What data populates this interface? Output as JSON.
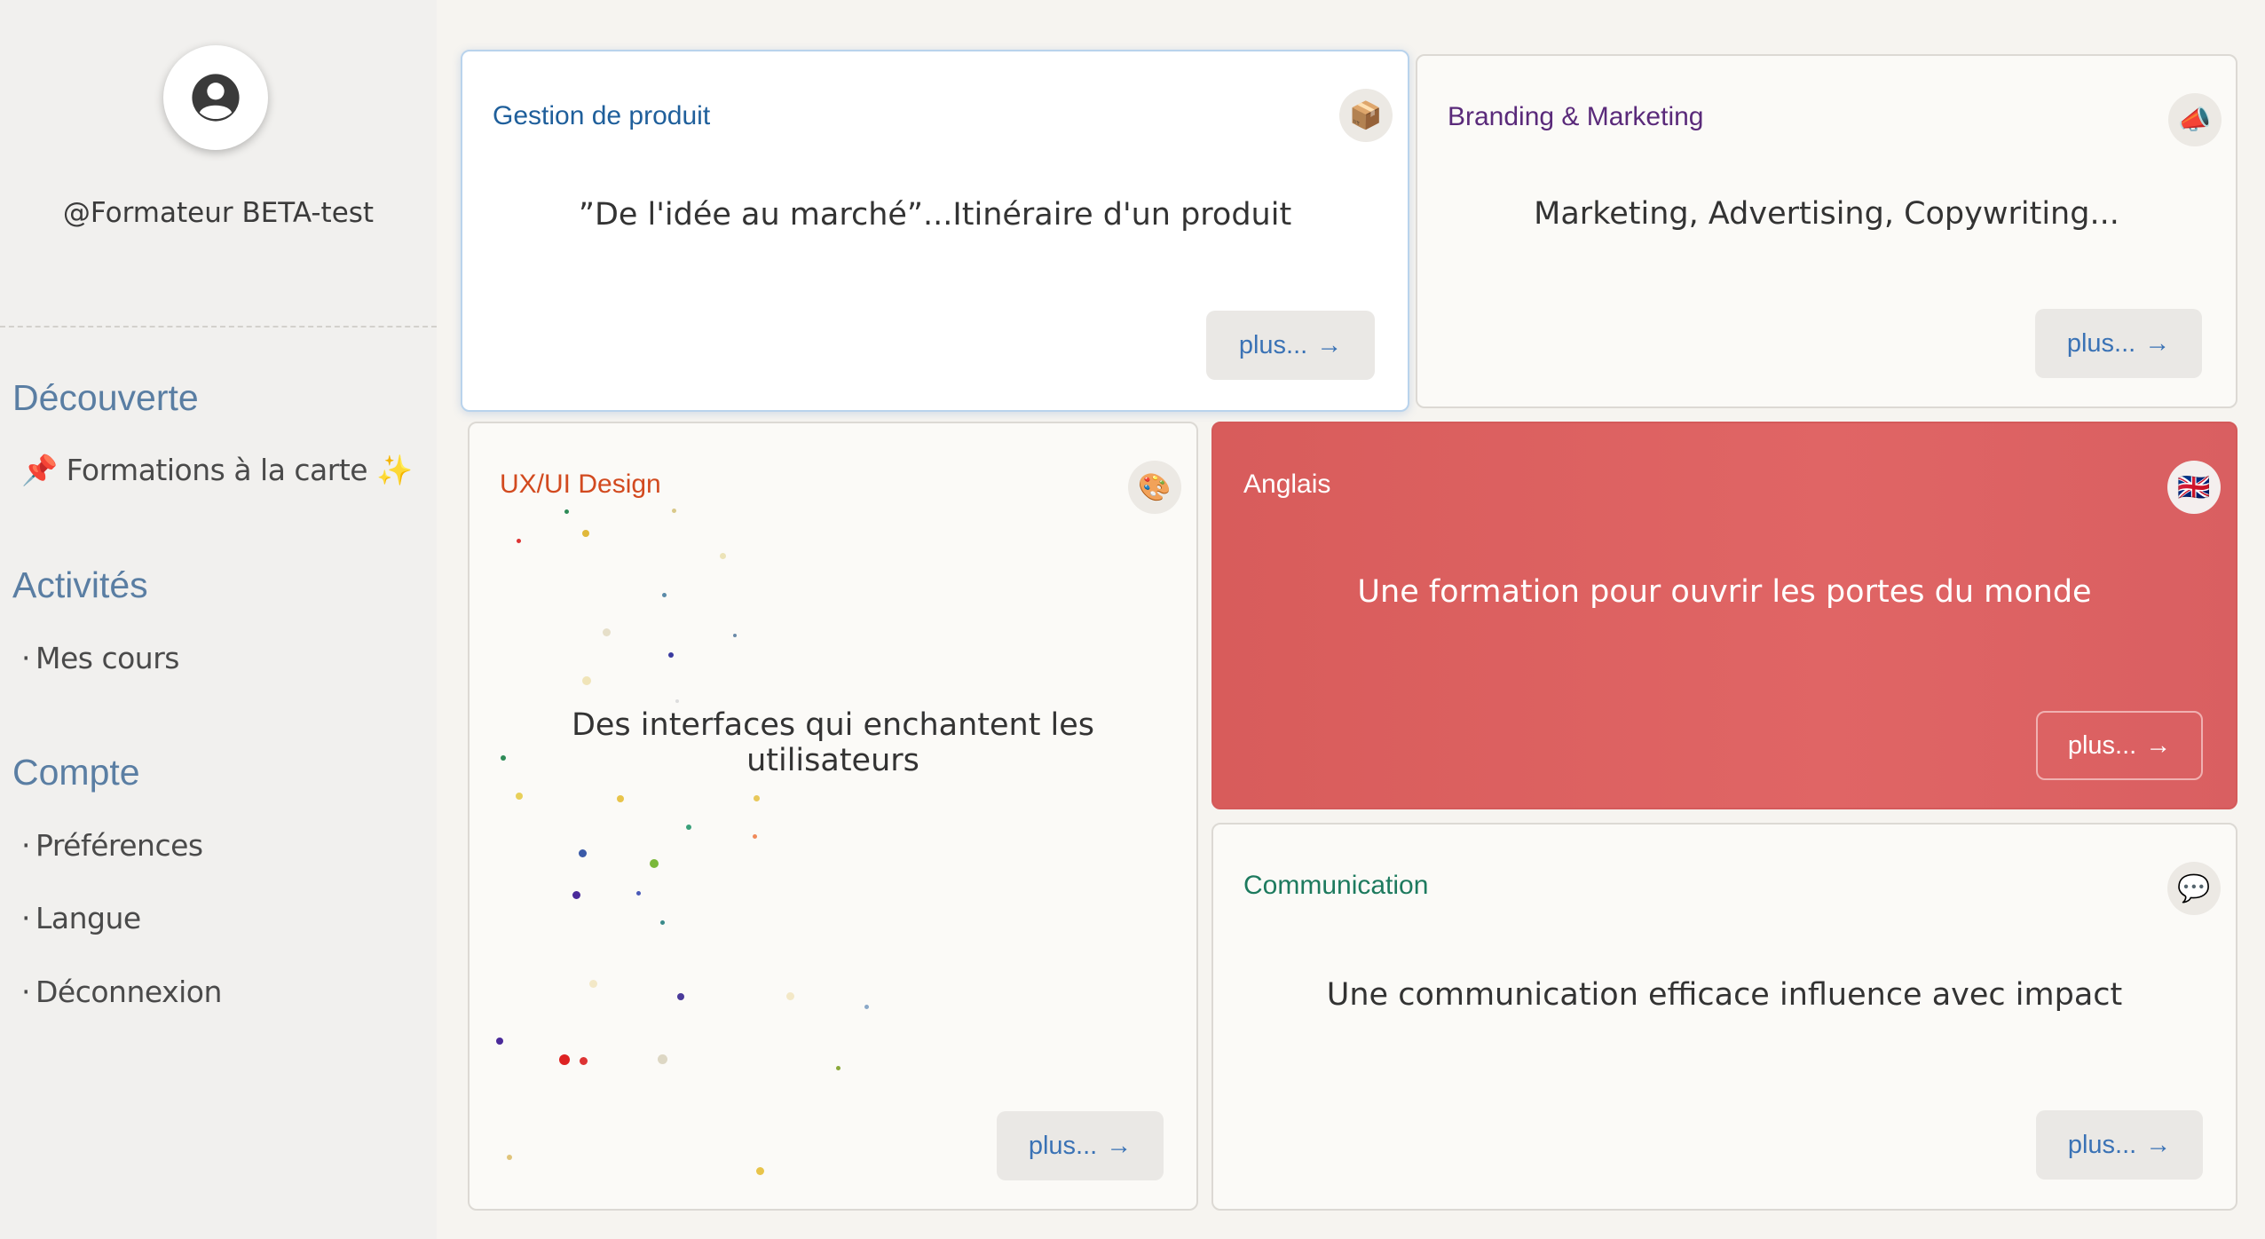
{
  "sidebar": {
    "username": "@Formateur BETA-test",
    "sections": [
      {
        "title": "Découverte",
        "items": [
          {
            "label": "📌 Formations à la carte  ✨"
          }
        ]
      },
      {
        "title": "Activités",
        "items": [
          {
            "label": "Mes cours"
          }
        ]
      },
      {
        "title": "Compte",
        "items": [
          {
            "label": "Préférences"
          },
          {
            "label": "Langue"
          },
          {
            "label": "Déconnexion"
          }
        ]
      }
    ]
  },
  "cards": {
    "produit": {
      "title": "Gestion de produit",
      "description": "”De l'idée au marché”...Itinéraire d'un produit",
      "button": "plus...",
      "icon": "📦",
      "title_color": "#1f5f9b"
    },
    "marketing": {
      "title": "Branding & Marketing",
      "description": "Marketing, Advertising, Copywriting...",
      "button": "plus...",
      "icon": "📣",
      "title_color": "#5a2a7a"
    },
    "design": {
      "title": "UX/UI Design",
      "description": "Des interfaces qui enchantent les utilisateurs",
      "button": "plus...",
      "icon": "🎨",
      "title_color": "#d24a1f"
    },
    "anglais": {
      "title": "Anglais",
      "description": "Une formation pour ouvrir les portes du monde",
      "button": "plus...",
      "icon": "🇬🇧",
      "title_color": "#ffffff"
    },
    "communication": {
      "title": "Communication",
      "description": "Une communication efficace influence avec impact",
      "button": "plus...",
      "icon": "💬",
      "title_color": "#1d7a5e"
    }
  },
  "colors": {
    "accent_blue": "#3a72b5",
    "section_title": "#5a7ea3",
    "anglais_bg": "#dd6060"
  }
}
